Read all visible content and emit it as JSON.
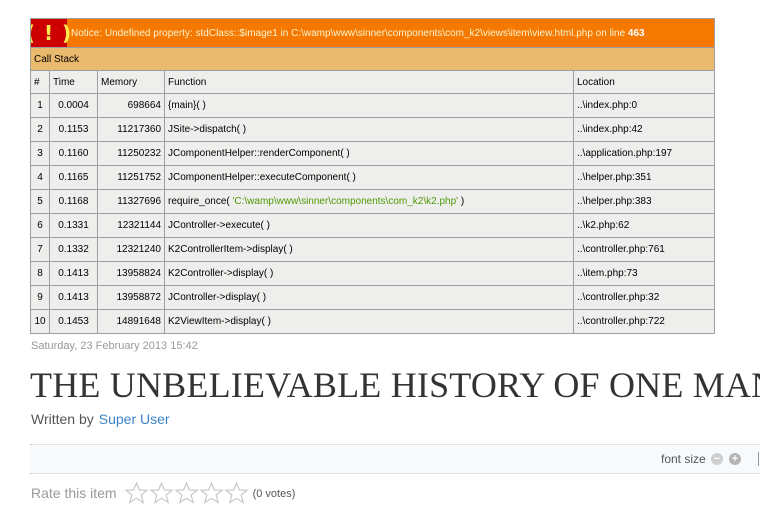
{
  "error": {
    "badge": "( ! )",
    "notice_prefix": "Notice: Undefined property: stdClass::$image1 in C:\\wamp\\www\\sinner\\components\\com_k2\\views\\item\\view.html.php on line ",
    "line": "463",
    "call_stack_label": "Call Stack",
    "columns": [
      "#",
      "Time",
      "Memory",
      "Function",
      "Location"
    ],
    "rows": [
      {
        "num": "1",
        "time": "0.0004",
        "memory": "698664",
        "function": "{main}( )",
        "location": "..\\index.php:0"
      },
      {
        "num": "2",
        "time": "0.1153",
        "memory": "11217360",
        "function": "JSite->dispatch( )",
        "location": "..\\index.php:42"
      },
      {
        "num": "3",
        "time": "0.1160",
        "memory": "11250232",
        "function": "JComponentHelper::renderComponent( )",
        "location": "..\\application.php:197"
      },
      {
        "num": "4",
        "time": "0.1165",
        "memory": "11251752",
        "function": "JComponentHelper::executeComponent( )",
        "location": "..\\helper.php:351"
      },
      {
        "num": "5",
        "time": "0.1168",
        "memory": "11327696",
        "function": "require_once( ",
        "func_arg": "'C:\\wamp\\www\\sinner\\components\\com_k2\\k2.php'",
        "func_close": " )",
        "location": "..\\helper.php:383"
      },
      {
        "num": "6",
        "time": "0.1331",
        "memory": "12321144",
        "function": "JController->execute( )",
        "location": "..\\k2.php:62"
      },
      {
        "num": "7",
        "time": "0.1332",
        "memory": "12321240",
        "function": "K2ControllerItem->display( )",
        "location": "..\\controller.php:761"
      },
      {
        "num": "8",
        "time": "0.1413",
        "memory": "13958824",
        "function": "K2Controller->display( )",
        "location": "..\\item.php:73"
      },
      {
        "num": "9",
        "time": "0.1413",
        "memory": "13958872",
        "function": "JController->display( )",
        "location": "..\\controller.php:32"
      },
      {
        "num": "10",
        "time": "0.1453",
        "memory": "14891648",
        "function": "K2ViewItem->display( )",
        "location": "..\\controller.php:722"
      }
    ]
  },
  "article": {
    "date": "Saturday, 23 February 2013 15:42",
    "title": "THE UNBELIEVABLE HISTORY OF ONE MAN",
    "written_by_label": "Written by",
    "author": "Super User"
  },
  "toolbar": {
    "font_size_label": "font size",
    "decrease_symbol": "−",
    "increase_symbol": "+"
  },
  "rating": {
    "label": "Rate this item",
    "stars": 5,
    "votes": "(0 votes)"
  }
}
